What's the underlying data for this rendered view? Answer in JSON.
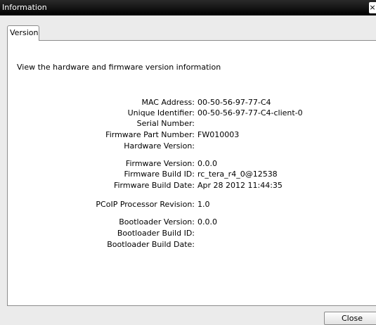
{
  "window": {
    "title": "Information",
    "close_glyph": "×",
    "close_icon": "close-icon"
  },
  "tabs": [
    {
      "label": "Version",
      "selected": true
    }
  ],
  "description": "View the hardware and firmware version information",
  "fields": {
    "mac_address": {
      "label": "MAC Address:",
      "value": "00-50-56-97-77-C4"
    },
    "unique_identifier": {
      "label": "Unique Identifier:",
      "value": "00-50-56-97-77-C4-client-0"
    },
    "serial_number": {
      "label": "Serial Number:",
      "value": ""
    },
    "firmware_part_number": {
      "label": "Firmware Part Number:",
      "value": "FW010003"
    },
    "hardware_version": {
      "label": "Hardware Version:",
      "value": ""
    },
    "firmware_version": {
      "label": "Firmware Version:",
      "value": "0.0.0"
    },
    "firmware_build_id": {
      "label": "Firmware Build ID:",
      "value": "rc_tera_r4_0@12538"
    },
    "firmware_build_date": {
      "label": "Firmware Build Date:",
      "value": "Apr 28 2012 11:44:35"
    },
    "pcoip_processor_revision": {
      "label": "PCoIP Processor Revision:",
      "value": "1.0"
    },
    "bootloader_version": {
      "label": "Bootloader Version:",
      "value": "0.0.0"
    },
    "bootloader_build_id": {
      "label": "Bootloader Build ID:",
      "value": ""
    },
    "bootloader_build_date": {
      "label": "Bootloader Build Date:",
      "value": ""
    }
  },
  "buttons": {
    "close_label": "Close"
  },
  "colors": {
    "titlebar": "#000000",
    "dialog_background": "#ebebeb",
    "panel_background": "#ffffff"
  }
}
